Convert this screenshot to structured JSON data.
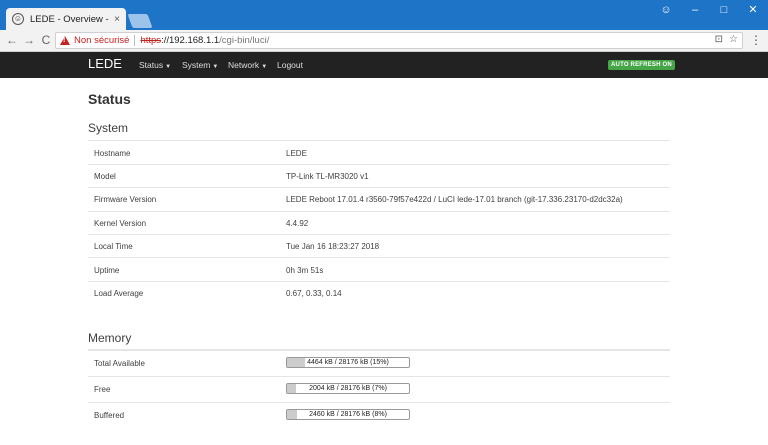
{
  "browser": {
    "tab_title": "LEDE - Overview - LuCI",
    "tab_close": "×",
    "favicon": "lede-icon",
    "security_text": "Non sécurisé",
    "url_scheme": "https",
    "url_host": "://192.168.1.1",
    "url_path": "/cgi-bin/luci/",
    "window_buttons": {
      "profile": "☺",
      "minimize": "–",
      "maximize": "□",
      "close": "✕"
    },
    "nav": {
      "back": "←",
      "forward": "→",
      "reload": "C"
    },
    "omni_icons": {
      "translate": "⊡",
      "bookmark": "☆"
    },
    "menu": "⋮"
  },
  "luci": {
    "brand": "LEDE",
    "menu": [
      {
        "label": "Status",
        "has_caret": true
      },
      {
        "label": "System",
        "has_caret": true
      },
      {
        "label": "Network",
        "has_caret": true
      },
      {
        "label": "Logout",
        "has_caret": false
      }
    ],
    "caret": "▼",
    "refresh_badge": "AUTO REFRESH ON"
  },
  "page": {
    "title": "Status",
    "system_section": {
      "title": "System",
      "rows": [
        {
          "label": "Hostname",
          "value": "LEDE"
        },
        {
          "label": "Model",
          "value": "TP-Link TL-MR3020 v1"
        },
        {
          "label": "Firmware Version",
          "value": "LEDE Reboot 17.01.4 r3560-79f57e422d / LuCI lede-17.01 branch (git-17.336.23170-d2dc32a)"
        },
        {
          "label": "Kernel Version",
          "value": "4.4.92"
        },
        {
          "label": "Local Time",
          "value": "Tue Jan 16 18:23:27 2018"
        },
        {
          "label": "Uptime",
          "value": "0h 3m 51s"
        },
        {
          "label": "Load Average",
          "value": "0.67, 0.33, 0.14"
        }
      ]
    },
    "memory_section": {
      "title": "Memory",
      "rows": [
        {
          "label": "Total Available",
          "bar_text": "4464 kB / 28176 kB (15%)",
          "fraction": 0.15
        },
        {
          "label": "Free",
          "bar_text": "2004 kB / 28176 kB (7%)",
          "fraction": 0.07
        },
        {
          "label": "Buffered",
          "bar_text": "2460 kB / 28176 kB (8%)",
          "fraction": 0.08
        }
      ]
    }
  },
  "colors": {
    "chrome_blue": "#1e74c6",
    "navbar": "#222222",
    "badge_green": "#46a546",
    "insecure_red": "#c5221f"
  }
}
